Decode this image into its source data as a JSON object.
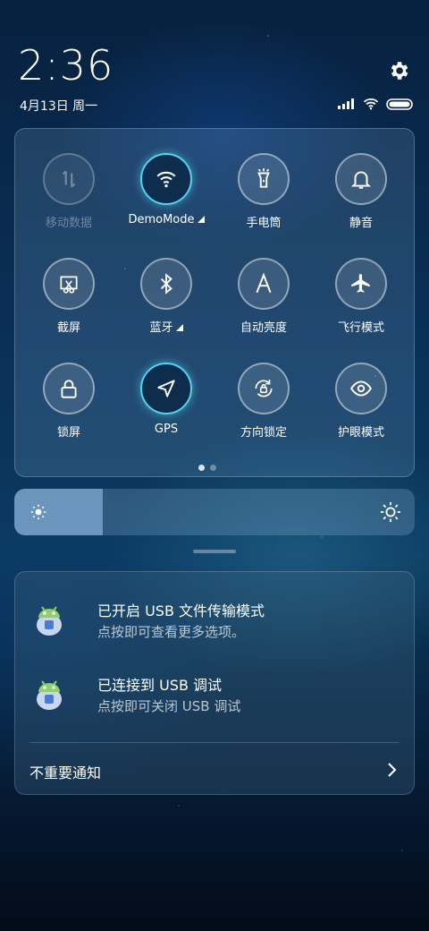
{
  "status_bar": {
    "time": "2:36",
    "date": "4月13日 周一",
    "icons": [
      "signal-icon",
      "wifi-icon",
      "battery-icon"
    ]
  },
  "quick_settings": {
    "tiles": [
      {
        "label": "移动数据",
        "icon": "mobile-data-icon",
        "state": "disabled"
      },
      {
        "label": "DemoMode",
        "icon": "wifi-icon",
        "state": "active",
        "has_arrow": true
      },
      {
        "label": "手电筒",
        "icon": "flashlight-icon",
        "state": "off"
      },
      {
        "label": "静音",
        "icon": "bell-icon",
        "state": "off"
      },
      {
        "label": "截屏",
        "icon": "screenshot-icon",
        "state": "off"
      },
      {
        "label": "蓝牙",
        "icon": "bluetooth-icon",
        "state": "off",
        "has_arrow": true
      },
      {
        "label": "自动亮度",
        "icon": "auto-brightness-icon",
        "state": "off"
      },
      {
        "label": "飞行模式",
        "icon": "airplane-icon",
        "state": "off"
      },
      {
        "label": "锁屏",
        "icon": "lock-icon",
        "state": "off"
      },
      {
        "label": "GPS",
        "icon": "location-icon",
        "state": "active"
      },
      {
        "label": "方向锁定",
        "icon": "rotation-lock-icon",
        "state": "off"
      },
      {
        "label": "护眼模式",
        "icon": "eye-icon",
        "state": "off"
      }
    ],
    "page_count": 2,
    "current_page": 0
  },
  "brightness": {
    "level": 0.22
  },
  "notifications": [
    {
      "title": "已开启 USB 文件传输模式",
      "subtitle": "点按即可查看更多选项。",
      "icon": "android-icon"
    },
    {
      "title": "已连接到 USB 调试",
      "subtitle": "点按即可关闭 USB 调试",
      "icon": "android-icon"
    }
  ],
  "unimportant_label": "不重要通知",
  "colors": {
    "accent": "#54d4f0"
  }
}
